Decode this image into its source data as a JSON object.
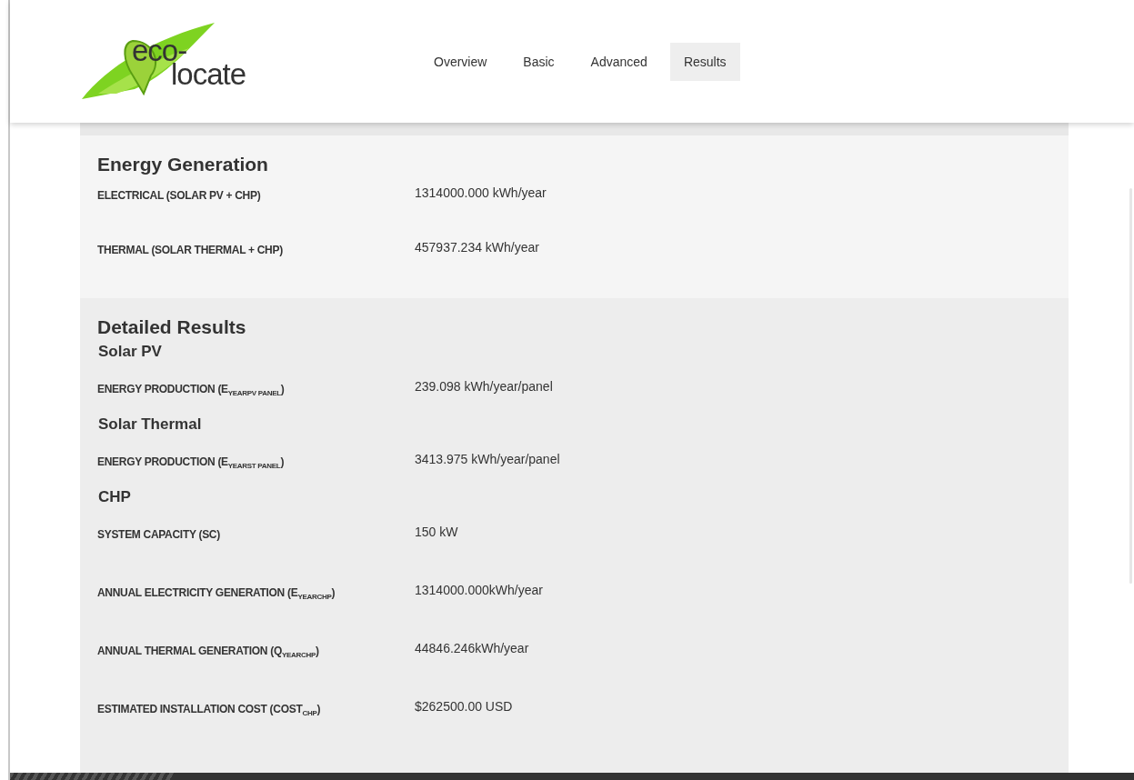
{
  "logo": {
    "line_1": "eco-",
    "line_2": "locate"
  },
  "nav": [
    {
      "label": "Overview",
      "selected": false
    },
    {
      "label": "Basic",
      "selected": false
    },
    {
      "label": "Advanced",
      "selected": false
    },
    {
      "label": "Results",
      "selected": true
    }
  ],
  "sections": [
    {
      "title": "Energy Generation",
      "groups": [
        {
          "rows": [
            {
              "label": "ELECTRICAL (SOLAR PV + CHP)",
              "value": "1314000.000 kWh/year"
            },
            {
              "label": "THERMAL (SOLAR THERMAL + CHP)",
              "value": "457937.234 kWh/year"
            }
          ]
        }
      ]
    },
    {
      "title": "Detailed Results",
      "groups": [
        {
          "heading": "Solar PV",
          "rows": [
            {
              "label": "ENERGY PRODUCTION (E$_{YEAR}$$_{PV PANEL}$)",
              "value": "239.098 kWh/year/panel"
            }
          ]
        },
        {
          "heading": "Solar Thermal",
          "rows": [
            {
              "label": "ENERGY PRODUCTION (E$_{YEAR}$$_{ST PANEL}$)",
              "value": "3413.975 kWh/year/panel"
            }
          ]
        },
        {
          "heading": "CHP",
          "rows": [
            {
              "label": "SYSTEM CAPACITY (SC)",
              "value": "150 kW"
            },
            {
              "label": "ANNUAL ELECTRICITY GENERATION (E$_{YEAR}$$_{CHP}$)",
              "value": "1314000.000kWh/year"
            },
            {
              "label": "ANNUAL THERMAL GENERATION (Q$_{YEAR}$$_{CHP}$)",
              "value": "44846.246kWh/year"
            },
            {
              "label": "ESTIMATED INSTALLATION COST (COST$_{CHP}$)",
              "value": "$262500.00 USD"
            }
          ]
        }
      ]
    }
  ]
}
